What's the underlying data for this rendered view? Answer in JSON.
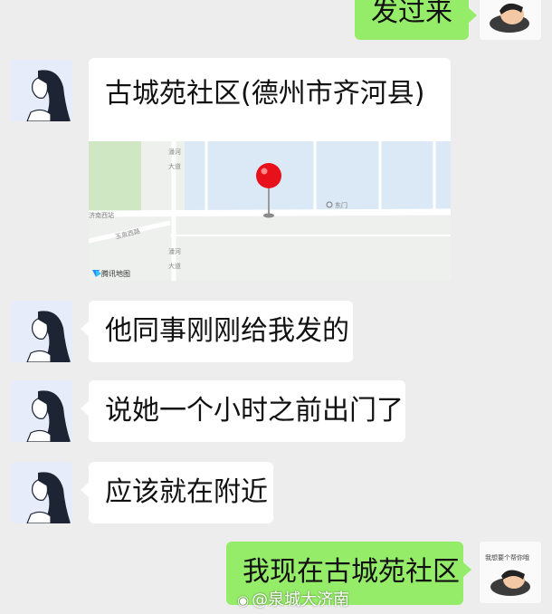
{
  "messages": {
    "m1": "发过来",
    "m3": "他同事刚刚给我发的",
    "m4": "说她一个小时之前出门了",
    "m5": "应该就在附近",
    "m6": "我现在古城苑社区"
  },
  "location": {
    "title": "古城苑社区(德州市齐河县)",
    "map": {
      "road_label_1a": "潘河",
      "road_label_1b": "大道",
      "road_label_2": "玉泉西路",
      "road_label_3a": "潘河",
      "road_label_3b": "大道",
      "poi_label": "东门",
      "poi_label_left": "济南西站",
      "provider": "腾讯地图"
    }
  },
  "sticker": {
    "caption": "我想要个帮你哦"
  },
  "watermark": {
    "icon": "weibo-icon",
    "text": "@泉城大济南"
  },
  "colors": {
    "chat_bg": "#ededed",
    "incoming_bubble": "#ffffff",
    "outgoing_bubble": "#95ec69",
    "map_water": "#dbe8f6",
    "map_green": "#cfe7c2",
    "pin": "#e8101a"
  }
}
